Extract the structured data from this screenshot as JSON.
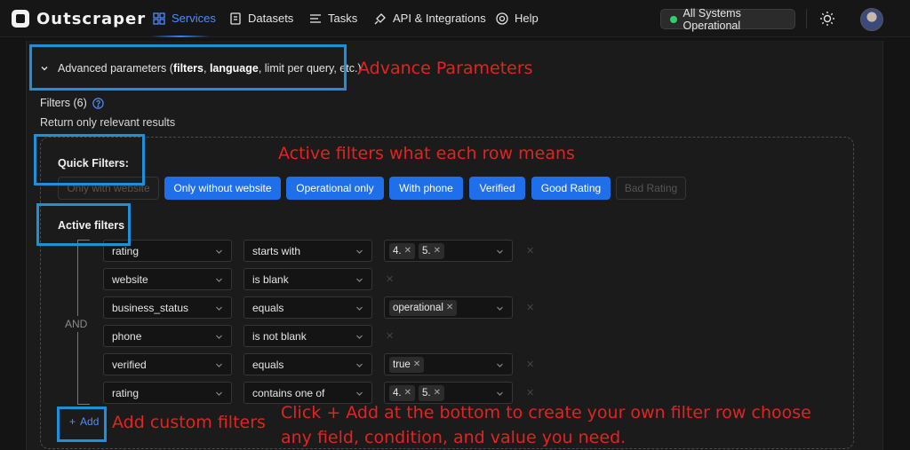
{
  "nav": {
    "brand": "Outscraper",
    "items": [
      {
        "label": "Services",
        "icon": "grid-icon",
        "active": true
      },
      {
        "label": "Datasets",
        "icon": "dataset-icon"
      },
      {
        "label": "Tasks",
        "icon": "tasks-icon"
      },
      {
        "label": "API & Integrations",
        "icon": "plug-icon"
      },
      {
        "label": "Help",
        "icon": "help-circle-icon"
      }
    ],
    "status": "All Systems Operational",
    "status_color": "#2fd06a",
    "accent": "#1f6feb"
  },
  "advanced": {
    "prefix": "Advanced parameters (",
    "bold1": "filters",
    "sep": ", ",
    "bold2": "language",
    "suffix": ", limit per query, etc.)"
  },
  "filters": {
    "title": "Filters (6)",
    "subtitle": "Return only relevant results",
    "quick_title": "Quick Filters:",
    "quick": [
      {
        "label": "Only with website",
        "on": false
      },
      {
        "label": "Only without website",
        "on": true
      },
      {
        "label": "Operational only",
        "on": true
      },
      {
        "label": "With phone",
        "on": true
      },
      {
        "label": "Verified",
        "on": true
      },
      {
        "label": "Good Rating",
        "on": true
      },
      {
        "label": "Bad Rating",
        "on": false
      }
    ],
    "active_title": "Active filters",
    "joiner": "AND",
    "rows": [
      {
        "field": "rating",
        "op": "starts with",
        "values": [
          "4.",
          "5."
        ]
      },
      {
        "field": "website",
        "op": "is blank",
        "values": null
      },
      {
        "field": "business_status",
        "op": "equals",
        "values": [
          "operational"
        ]
      },
      {
        "field": "phone",
        "op": "is not blank",
        "values": null
      },
      {
        "field": "verified",
        "op": "equals",
        "values": [
          "true"
        ]
      },
      {
        "field": "rating",
        "op": "contains one of",
        "values": [
          "4.",
          "5."
        ]
      }
    ],
    "add_label": "Add"
  },
  "annotations": {
    "advance": "Advance Parameters",
    "active": "Active filters what each row means",
    "custom": "Add custom filters",
    "click_line1": "Click + Add at the bottom to create your own filter row  choose",
    "click_line2": "any field, condition, and value you need."
  }
}
